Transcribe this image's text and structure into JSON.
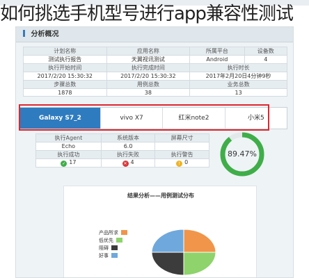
{
  "title": "如何挑选手机型号进行app兼容性测试",
  "section": {
    "header": "分析概况"
  },
  "summary": {
    "row1_headers": [
      "计划名称",
      "应用名称",
      "所属平台",
      "设备数"
    ],
    "row1_values": [
      "测试执行报告",
      "天翼视讯测试",
      "Android",
      "4"
    ],
    "row2_headers": [
      "执行开始时间",
      "执行完成时间",
      "执行时长"
    ],
    "row2_values": [
      "2017/2/20 15:30:32",
      "2017/2/20 15:30:32",
      "2017年2月20日4分钟9秒"
    ],
    "row3_headers": [
      "步骤总数",
      "用例总数",
      "业务总数"
    ],
    "row3_values": [
      "1878",
      "38",
      "13"
    ]
  },
  "devices": [
    "Galaxy S7_2",
    "vivo X7",
    "红米note2",
    "小米5"
  ],
  "device_detail": {
    "row1_headers": [
      "执行Agent",
      "系统版本",
      "屏幕尺寸"
    ],
    "row1_values": [
      "Echo",
      "6.0",
      ""
    ],
    "row2_headers": [
      "执行成功",
      "执行失败",
      "执行警告"
    ],
    "row2_values": [
      "17",
      "4",
      "0"
    ]
  },
  "gauge": {
    "percent_label": "89.47%",
    "percent": 89.47
  },
  "chart_data": {
    "type": "pie",
    "title": "结果分析——用例测试分布",
    "categories": [
      "产品所求",
      "低优先",
      "阻碍",
      "好事"
    ],
    "values": [
      25,
      25,
      25,
      25
    ],
    "colors": [
      "#f0954a",
      "#8ed36b",
      "#3c3c3c",
      "#6fa8dc"
    ]
  }
}
